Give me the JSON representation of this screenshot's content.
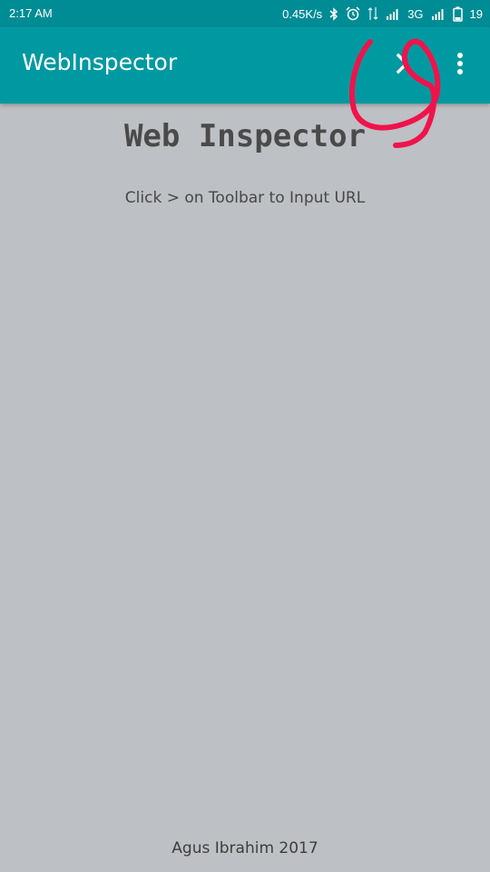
{
  "status_bar": {
    "time": "2:17 AM",
    "net_speed": "0.45K/s",
    "network_type": "3G",
    "battery": "19",
    "icons": [
      "bluetooth-icon",
      "alarm-icon",
      "data-arrows-icon",
      "signal-icon",
      "signal-icon",
      "battery-icon"
    ]
  },
  "toolbar": {
    "title": "WebInspector",
    "actions": [
      "chevron-right-icon",
      "more-vert-icon"
    ]
  },
  "content": {
    "heading": "Web Inspector",
    "hint": "Click > on Toolbar to Input URL"
  },
  "footer": {
    "credit": "Agus Ibrahim 2017"
  },
  "colors": {
    "status_bar": "#008c95",
    "toolbar": "#0199a1",
    "background": "#bdc0c4",
    "annotation": "#f0134b"
  }
}
